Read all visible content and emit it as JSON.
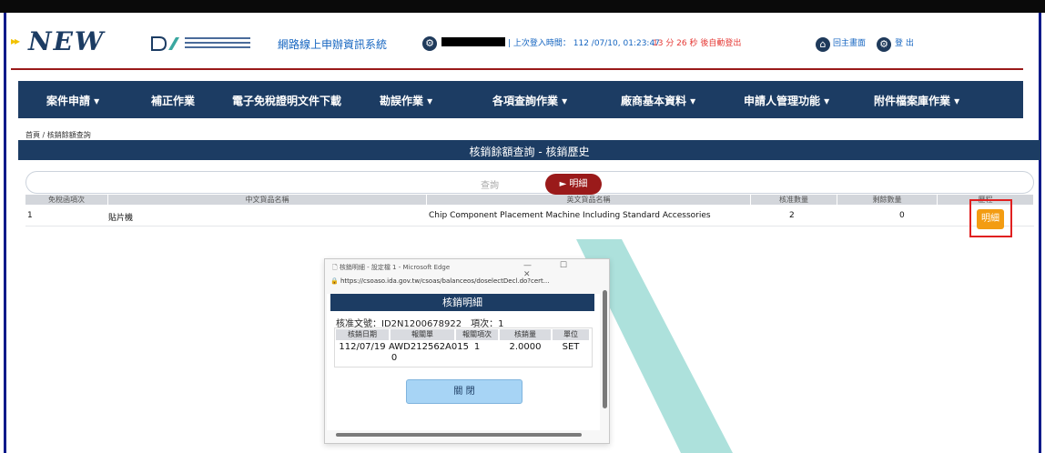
{
  "header": {
    "logo_arrows": "▸▸",
    "logo_text": "NEW",
    "ida_logo_name": "industrial-development-administration-logo",
    "system_title": "網路線上申辦資訊系統",
    "last_login": "| 上次登入時間： 112 /07/10, 01:23:47",
    "auto_logout": "13 分 26 秒 後自動登出",
    "home_label": "回主畫面",
    "logout_label": "登 出"
  },
  "nav": {
    "items": [
      {
        "label": "案件申請 ▾"
      },
      {
        "label": "補正作業"
      },
      {
        "label": "電子免稅證明文件下載"
      },
      {
        "label": "勘誤作業 ▾"
      },
      {
        "label": "各項查詢作業 ▾"
      },
      {
        "label": "廠商基本資料 ▾"
      },
      {
        "label": "申請人管理功能 ▾"
      },
      {
        "label": "附件檔案庫作業 ▾"
      }
    ]
  },
  "breadcrumb": "首頁 / 核銷餘額查詢",
  "page_title": "核銷餘額查詢 - 核銷歷史",
  "query": {
    "query_label": "查詢",
    "detail_button": "► 明細"
  },
  "table": {
    "columns": [
      "免稅函項次",
      "中文貨品名稱",
      "英文貨品名稱",
      "核准數量",
      "剩餘數量",
      "歷程"
    ],
    "rows": [
      {
        "item_no": "1",
        "cn_name": "貼片機",
        "en_name": "Chip Component Placement Machine Including Standard Accessories",
        "approved_qty": "2",
        "remaining_qty": "0",
        "history_button": "明細"
      }
    ]
  },
  "popup": {
    "window_title": "核銷明細 - 設定檔 1 - Microsoft Edge",
    "window_controls": "— ☐ ✕",
    "url": "https://csoaso.ida.gov.tw/csoas/balanceos/doselectDecl.do?cert...",
    "header": "核銷明細",
    "doc_no": "核准文號：ID2N1200678922　項次：1",
    "columns": [
      "核銷日期",
      "報關單",
      "報關項次",
      "核銷量",
      "單位"
    ],
    "row": {
      "date": "112/07/19",
      "declaration": "AWD212562A015",
      "declaration_cont": "0",
      "item": "1",
      "amount": "2.0000",
      "unit": "SET"
    },
    "close_button": "關 閉"
  },
  "colors": {
    "navy": "#1c3c63",
    "maroon": "#9a1a1a",
    "orange": "#f39c12",
    "highlight_red": "#e02020",
    "teal": "#9fdcd6"
  }
}
